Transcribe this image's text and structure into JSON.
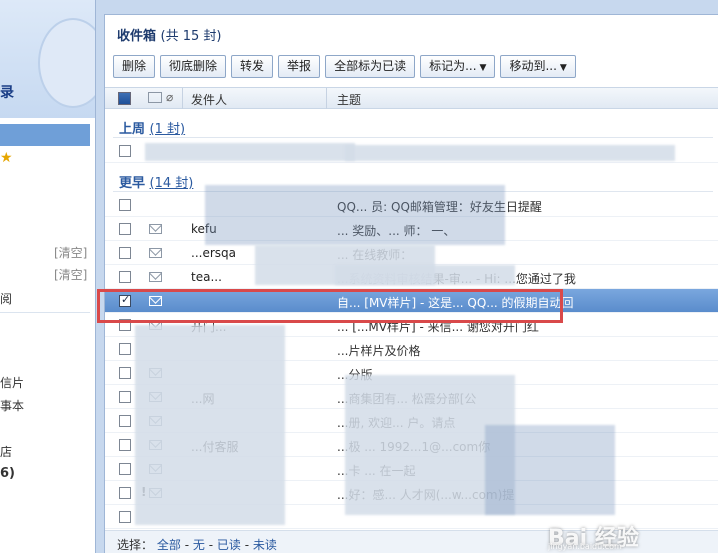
{
  "sidebar": {
    "logo_text": "录",
    "clear_1": "[清空]",
    "clear_2": "[清空]",
    "item_subscribe": "阅",
    "item_postcard": "信片",
    "item_notes": "事本",
    "item_more": "店",
    "item_count": "6)"
  },
  "main": {
    "title": "收件箱",
    "title_count": "(共 15 封)"
  },
  "toolbar": {
    "delete": "删除",
    "delete_permanent": "彻底删除",
    "forward": "转发",
    "report": "举报",
    "mark_all_read": "全部标为已读",
    "mark_as": "标记为...",
    "move_to": "移动到..."
  },
  "list_header": {
    "sender": "发件人",
    "subject": "主题"
  },
  "groups": {
    "last_week_label": "上周",
    "last_week_count": "(1 封)",
    "earlier_label": "更早",
    "earlier_count": "(14 封)"
  },
  "rows": [
    {
      "sender": "",
      "subject": ""
    },
    {
      "sender": "",
      "subject": "QQ... 员: QQ邮箱管理：好友生日提醒"
    },
    {
      "sender": "kefu",
      "subject": "... 奖励、... 师： 一、"
    },
    {
      "sender": "...ersqa",
      "subject": "... 在线教师："
    },
    {
      "sender": "tea...",
      "subject": "...系统资料审核结果-审... - Hi: ...您通过了我"
    },
    {
      "sender": "",
      "subject": "自... [MV样片] - 这是... QQ... 的假期自动回"
    },
    {
      "sender": "开门...",
      "subject": "... [...MV样片] - 来信... 谢您对开门红"
    },
    {
      "sender": "",
      "subject": "...片样片及价格"
    },
    {
      "sender": "",
      "subject": "...分版"
    },
    {
      "sender": "...网",
      "subject": "...商集团有... 松霞分部[公"
    },
    {
      "sender": "",
      "subject": "...册, 欢迎... 户。请点"
    },
    {
      "sender": "...付客服",
      "subject": "...极 ... 1992...1@...com你"
    },
    {
      "sender": "",
      "subject": "...卡 ... 在一起"
    },
    {
      "sender": "",
      "subject": "...好：感... 人才网(...w...com)提"
    },
    {
      "sender": "",
      "subject": ""
    }
  ],
  "footer": {
    "prefix": "选择：",
    "all": "全部",
    "none": "无",
    "read": "已读",
    "unread": "未读",
    "dash": "-"
  },
  "watermark": {
    "text": "Bai 经验",
    "sub": "jingyan.baidu.com"
  }
}
